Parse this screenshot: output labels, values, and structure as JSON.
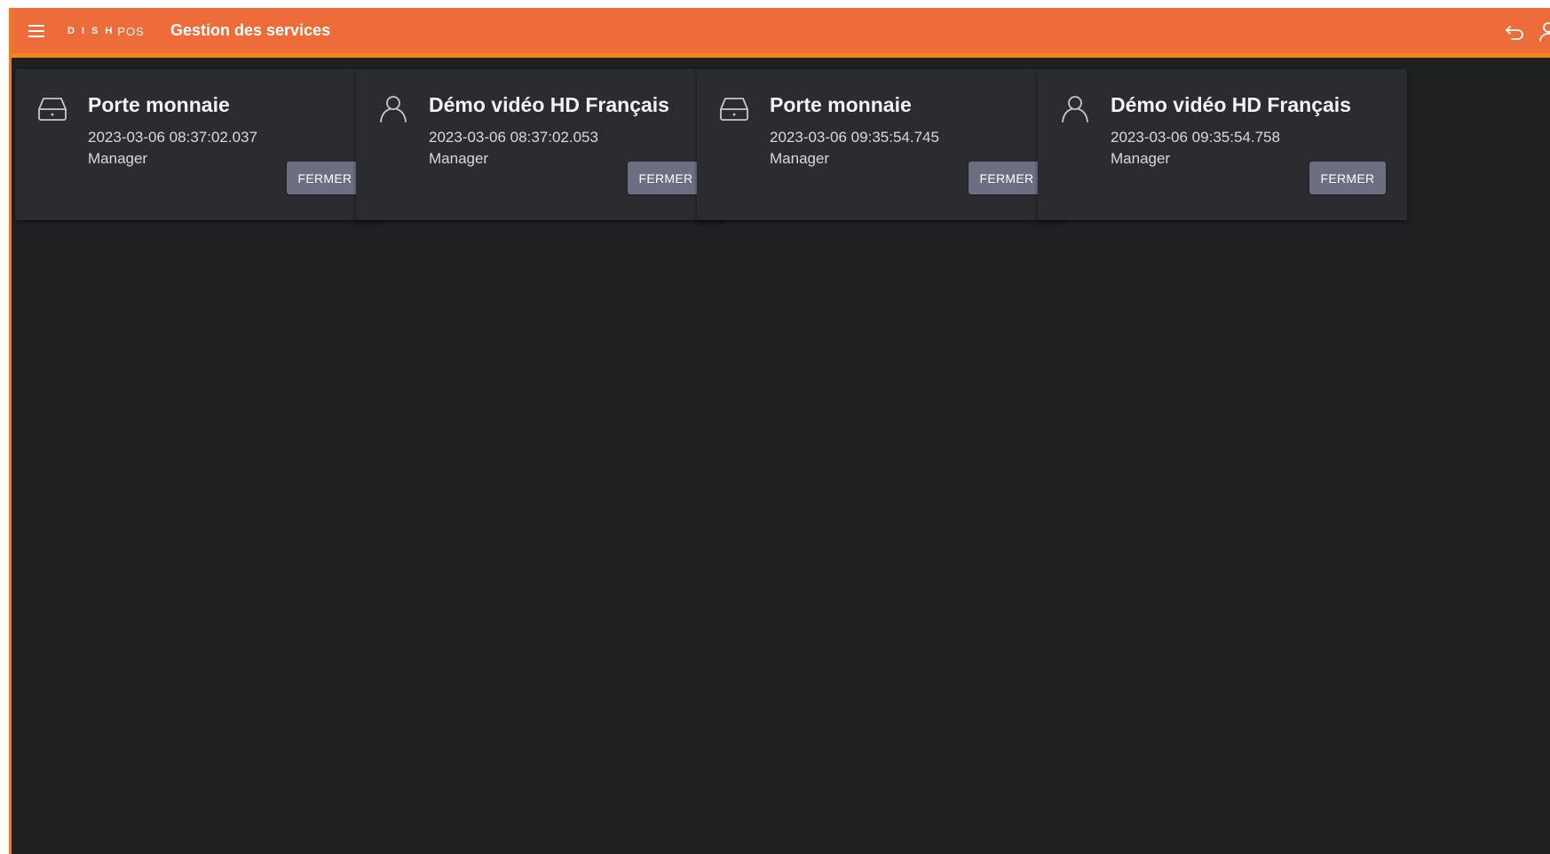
{
  "header": {
    "logo_dish": "DISH",
    "logo_pos": "POS",
    "title": "Gestion des services",
    "icons": [
      "menu-icon",
      "undo-icon",
      "user-off-icon"
    ]
  },
  "colors": {
    "header_bg": "#ee6c3a",
    "header_accent": "#f58412",
    "background": "#1f2022",
    "card_bg": "#2b2c30",
    "button_bg": "#6c6f82"
  },
  "services": [
    {
      "icon": "cash-drawer-icon",
      "title": "Porte monnaie",
      "timestamp": "2023-03-06 08:37:02.037",
      "role": "Manager",
      "button_label": "FERMER"
    },
    {
      "icon": "user-icon",
      "title": "Démo vidéo HD Français",
      "timestamp": "2023-03-06 08:37:02.053",
      "role": "Manager",
      "button_label": "FERMER"
    },
    {
      "icon": "cash-drawer-icon",
      "title": "Porte monnaie",
      "timestamp": "2023-03-06 09:35:54.745",
      "role": "Manager",
      "button_label": "FERMER"
    },
    {
      "icon": "user-icon",
      "title": "Démo vidéo HD Français",
      "timestamp": "2023-03-06 09:35:54.758",
      "role": "Manager",
      "button_label": "FERMER"
    }
  ]
}
